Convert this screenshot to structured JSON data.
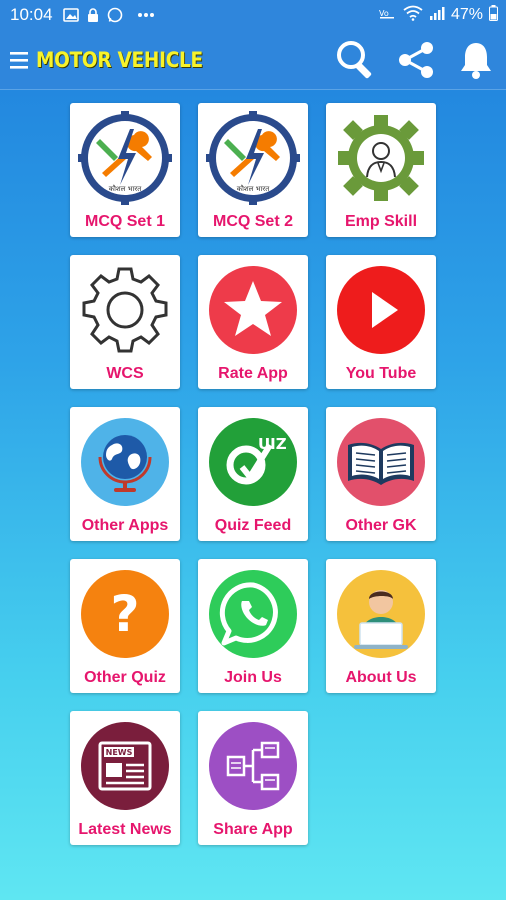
{
  "status_bar": {
    "time": "10:04",
    "battery": "47%",
    "icons": [
      "image-icon",
      "lock-icon",
      "whatsapp-icon",
      "more-icon",
      "vowifi-icon",
      "wifi-icon",
      "signal-icon",
      "battery-icon"
    ]
  },
  "app_bar": {
    "title": "MOTOR VEHICLE",
    "title_color": "#f7f32a",
    "background": "#2f86dc",
    "actions": [
      "search-icon",
      "share-icon",
      "bell-icon"
    ]
  },
  "tiles": [
    {
      "label": "MCQ Set 1",
      "icon": "skill-india-logo"
    },
    {
      "label": "MCQ Set 2",
      "icon": "skill-india-logo"
    },
    {
      "label": "Emp Skill",
      "icon": "gear-person-icon"
    },
    {
      "label": "WCS",
      "icon": "gear-icon"
    },
    {
      "label": "Rate App",
      "icon": "star-icon"
    },
    {
      "label": "You Tube",
      "icon": "play-icon"
    },
    {
      "label": "Other Apps",
      "icon": "globe-icon"
    },
    {
      "label": "Quiz Feed",
      "icon": "quiz-icon"
    },
    {
      "label": "Other GK",
      "icon": "book-icon"
    },
    {
      "label": "Other Quiz",
      "icon": "question-icon"
    },
    {
      "label": "Join Us",
      "icon": "whatsapp-icon"
    },
    {
      "label": "About Us",
      "icon": "person-laptop-icon"
    },
    {
      "label": "Latest News",
      "icon": "news-icon"
    },
    {
      "label": "Share App",
      "icon": "share-diagram-icon"
    }
  ],
  "label_color": "#e6166d"
}
